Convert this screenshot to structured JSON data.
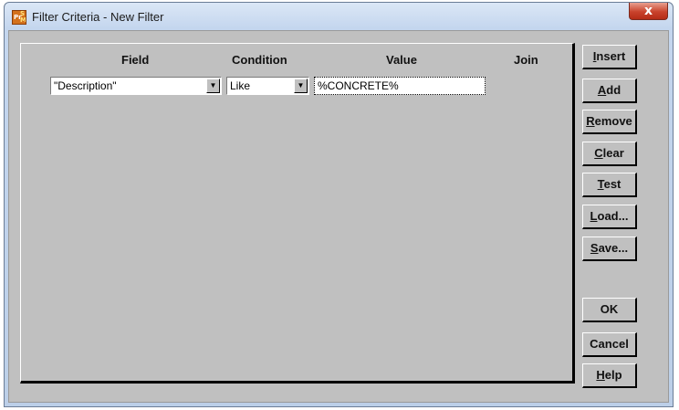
{
  "window": {
    "title": "Filter Criteria - New Filter",
    "close_symbol": "x"
  },
  "columns": {
    "field": "Field",
    "condition": "Condition",
    "value": "Value",
    "join": "Join"
  },
  "row": {
    "field": "\"Description\"",
    "condition": "Like",
    "value": "%CONCRETE%",
    "dropdown_arrow": "▼"
  },
  "buttons": {
    "insert": {
      "mn": "I",
      "rest": "nsert"
    },
    "add": {
      "mn": "A",
      "rest": "dd"
    },
    "remove": {
      "mn": "R",
      "rest": "emove"
    },
    "clear": {
      "mn": "C",
      "rest": "lear"
    },
    "test": {
      "mn": "T",
      "rest": "est"
    },
    "load": {
      "mn": "L",
      "rest": "oad..."
    },
    "save": {
      "mn": "S",
      "rest": "ave..."
    },
    "ok": {
      "label": "OK"
    },
    "cancel": {
      "label": "Cancel"
    },
    "help": {
      "mn": "H",
      "rest": "elp"
    }
  }
}
